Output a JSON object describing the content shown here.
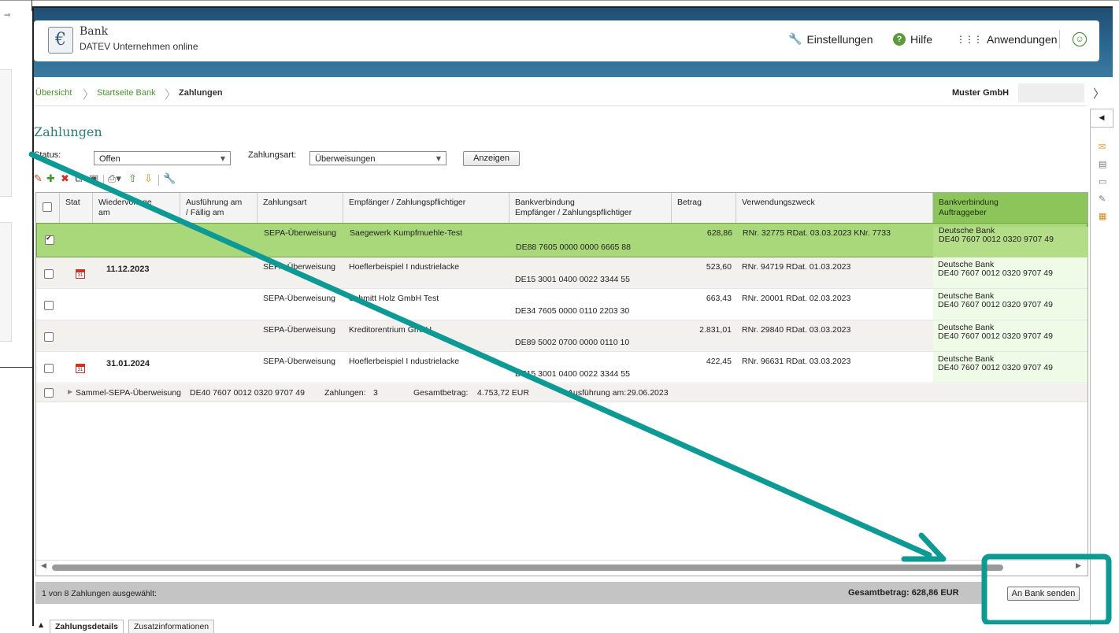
{
  "app": {
    "title": "Bank",
    "subtitle": "DATEV Unternehmen online",
    "logo_glyph": "€",
    "nav": {
      "settings": "Einstellungen",
      "help": "Hilfe",
      "apps": "Anwendungen"
    }
  },
  "breadcrumb": {
    "items": [
      "Übersicht",
      "Startseite Bank",
      "Zahlungen"
    ],
    "company": "Muster GmbH"
  },
  "page": {
    "title": "Zahlungen",
    "status_label": "Status:",
    "status_value": "Offen",
    "zahlungsart_label": "Zahlungsart:",
    "zahlungsart_value": "Überweisungen",
    "show_button": "Anzeigen"
  },
  "grid": {
    "columns": [
      "Status",
      "Wiedervorlage am",
      "Ausführung am / Fällig am",
      "Zahlungsart",
      "Empfänger / Zahlungspflichtiger",
      "Bankverbindung Empfänger / Zahlungspflichtiger",
      "Betrag",
      "Verwendungszweck",
      "Bankverbindung Auftraggeber"
    ],
    "header_lines": {
      "status": "Stat",
      "wiedervorlage_1": "Wiedervorlage",
      "wiedervorlage_2": "am",
      "ausfuehrung_1": "Ausführung am",
      "ausfuehrung_2": "/ Fällig am",
      "zahlungsart": "Zahlungsart",
      "empfaenger": "Empfänger / Zahlungspflichtiger",
      "bankverb_1": "Bankverbindung",
      "bankverb_2": "Empfänger / Zahlungspflichtiger",
      "betrag": "Betrag",
      "zweck": "Verwendungszweck",
      "auftr_1": "Bankverbindung",
      "auftr_2": "Auftraggeber"
    },
    "rows": [
      {
        "checked": true,
        "calendar": false,
        "date": "",
        "type": "SEPA-Überweisung",
        "recipient": "Saegewerk Kumpfmuehle-Test",
        "iban": "DE88 7605 0000 0000 6665 88",
        "amount": "628,86",
        "purpose": "RNr. 32775 RDat. 03.03.2023 KNr. 7733",
        "bank_name": "Deutsche Bank",
        "bank_iban": "DE40 7607 0012 0320 9707 49"
      },
      {
        "checked": false,
        "calendar": true,
        "date": "11.12.2023",
        "type": "SEPA-Überweisung",
        "recipient": "Hoeflerbeispiel I ndustrielacke",
        "iban": "DE15 3001 0400 0022 3344 55",
        "amount": "523,60",
        "purpose": "RNr. 94719 RDat. 01.03.2023",
        "bank_name": "Deutsche Bank",
        "bank_iban": "DE40 7607 0012 0320 9707 49"
      },
      {
        "checked": false,
        "calendar": false,
        "date": "",
        "type": "SEPA-Überweisung",
        "recipient": "Schmitt Holz GmbH Test",
        "iban": "DE34 7605 0000 0110 2203 30",
        "amount": "663,43",
        "purpose": "RNr. 20001 RDat. 02.03.2023",
        "bank_name": "Deutsche Bank",
        "bank_iban": "DE40 7607 0012 0320 9707 49"
      },
      {
        "checked": false,
        "calendar": false,
        "date": "",
        "type": "SEPA-Überweisung",
        "recipient": "Kreditorentrium GmbH",
        "iban": "DE89 5002 0700 0000 0110 10",
        "amount": "2.831,01",
        "purpose": "RNr. 29840 RDat. 03.03.2023",
        "bank_name": "Deutsche Bank",
        "bank_iban": "DE40 7607 0012 0320 9707 49"
      },
      {
        "checked": false,
        "calendar": true,
        "date": "31.01.2024",
        "type": "SEPA-Überweisung",
        "recipient": "Hoeflerbeispiel I ndustrielacke",
        "iban": "DE15 3001 0400 0022 3344 55",
        "amount": "422,45",
        "purpose": "RNr. 96631 RDat. 03.03.2023",
        "bank_name": "Deutsche Bank",
        "bank_iban": "DE40 7607 0012 0320 9707 49"
      }
    ],
    "sammel": {
      "label": "Sammel-SEPA-Überweisung",
      "iban": "DE40 7607 0012 0320 9707 49",
      "count_label": "Zahlungen:",
      "count": "3",
      "total_label": "Gesamtbetrag:",
      "total": "4.753,72 EUR",
      "exec_label": "Ausführung am:",
      "exec_date": "29.06.2023"
    },
    "calendar_glyph": "31"
  },
  "footer": {
    "selection": "1 von 8 Zahlungen ausgewählt:",
    "total": "Gesamtbetrag: 628,86 EUR",
    "send_button": "An Bank senden"
  },
  "tabs": [
    "Zahlungsdetails",
    "Zusatzinformationen"
  ],
  "colors": {
    "header": "#2c6a93",
    "accent_green": "#8cc65a",
    "selected_row": "#a8d87a",
    "annotation": "#0e9a94"
  },
  "icons": {
    "toolbar": [
      "edit-icon",
      "add-icon",
      "delete-icon",
      "copy-icon",
      "paste-icon",
      "print-icon",
      "move-up-icon",
      "move-down-icon",
      "tools-icon"
    ],
    "rail": [
      "mail-icon",
      "document-icon",
      "card-icon",
      "note-icon",
      "clipboard-icon"
    ]
  }
}
